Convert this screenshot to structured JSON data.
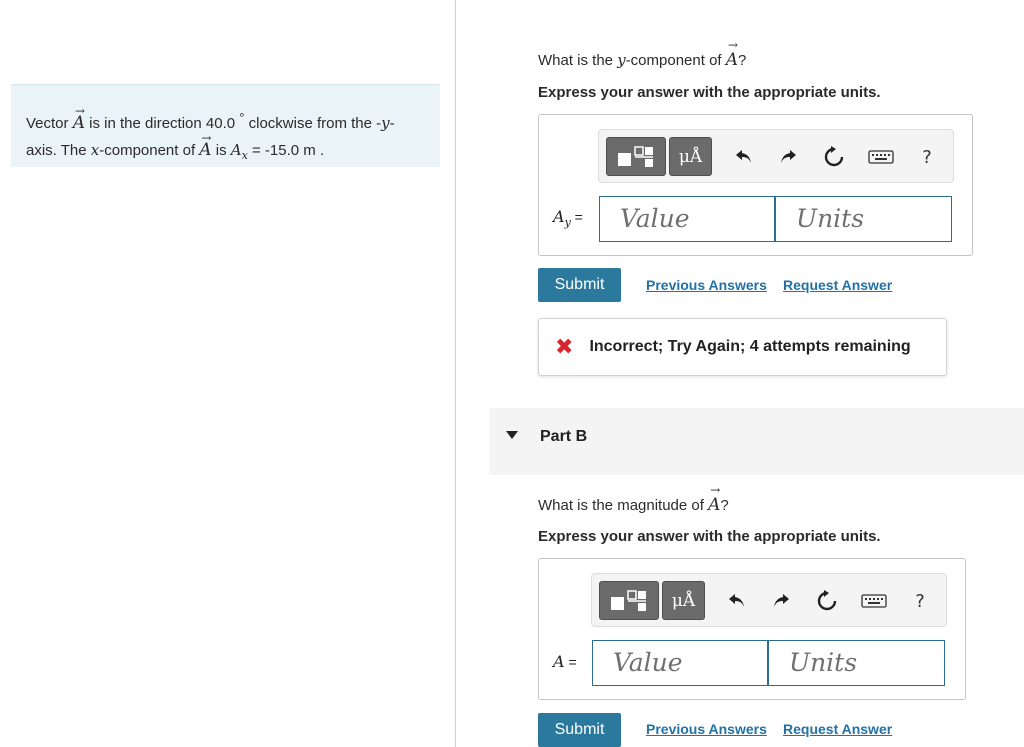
{
  "problem": {
    "text_1": "Vector",
    "vector": "A",
    "text_2": "is in the direction 40.0",
    "degree": "°",
    "text_3": "clockwise from the -",
    "y_var": "y",
    "text_4": "-",
    "text_5": "axis. The",
    "x_var": "x",
    "text_6": "-component of",
    "text_7": "is",
    "ax_label": "A",
    "ax_sub": "x",
    "ax_value": " = -15.0 m ."
  },
  "part_a": {
    "question_pre": "What is the",
    "question_var": "y",
    "question_mid": "-component of",
    "question_vec": "A",
    "question_end": "?",
    "instruction": "Express your answer with the appropriate units.",
    "var_label": "A",
    "var_sub": "y",
    "eq": " =",
    "value_placeholder": "Value",
    "units_placeholder": "Units",
    "submit": "Submit",
    "previous_answers": "Previous Answers",
    "request_answer": "Request Answer",
    "feedback": "Incorrect; Try Again; 4 attempts remaining"
  },
  "part_b": {
    "title": "Part B",
    "question_pre": "What is the magnitude of",
    "question_vec": "A",
    "question_end": "?",
    "instruction": "Express your answer with the appropriate units.",
    "var_label": "A",
    "eq": " =",
    "value_placeholder": "Value",
    "units_placeholder": "Units",
    "submit": "Submit",
    "previous_answers": "Previous Answers",
    "request_answer": "Request Answer"
  },
  "toolbar": {
    "units_symbol": "μÅ",
    "help": "?",
    "icons": [
      "templates-icon",
      "units-icon",
      "undo-icon",
      "redo-icon",
      "reset-icon",
      "keyboard-icon",
      "help-icon"
    ]
  },
  "colors": {
    "accent": "#2b7a9e",
    "link": "#2371a6",
    "error": "#d9262e",
    "problem_bg": "#eaf4f8",
    "field_border": "#2d6c8f"
  }
}
